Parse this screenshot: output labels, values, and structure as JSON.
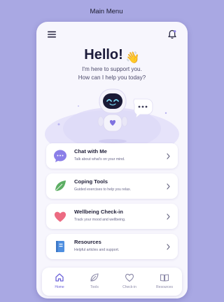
{
  "screen": {
    "title": "Main Menu"
  },
  "header": {
    "greeting": "Hello!",
    "wave_emoji": "👋",
    "subtitle_line1": "I'm here to support you.",
    "subtitle_line2": "How can I help you today?"
  },
  "icons": {
    "menu": "hamburger-menu-icon",
    "notifications": "bell-icon",
    "chat_bubble_text": "•••"
  },
  "cards": [
    {
      "title": "Chat with Me",
      "description": "Talk about what's on your mind.",
      "icon": "chat-bubble-icon",
      "color": "#8b7fe8"
    },
    {
      "title": "Coping Tools",
      "description": "Guided exercises to help you relax.",
      "icon": "leaf-icon",
      "color": "#5cae63"
    },
    {
      "title": "Wellbeing Check-in",
      "description": "Track your mood and wellbeing.",
      "icon": "heart-icon",
      "color": "#ec6b82"
    },
    {
      "title": "Resources",
      "description": "Helpful articles and support.",
      "icon": "book-icon",
      "color": "#4f8fe0"
    }
  ],
  "tabs": [
    {
      "label": "Home",
      "icon": "home-icon",
      "active": true
    },
    {
      "label": "Tools",
      "icon": "leaf-outline-icon",
      "active": false
    },
    {
      "label": "Check-in",
      "icon": "heart-outline-icon",
      "active": false
    },
    {
      "label": "Resources",
      "icon": "book-outline-icon",
      "active": false
    }
  ],
  "colors": {
    "background": "#a9a8e3",
    "accent": "#6c63d9",
    "surface": "#f7f6fd"
  }
}
